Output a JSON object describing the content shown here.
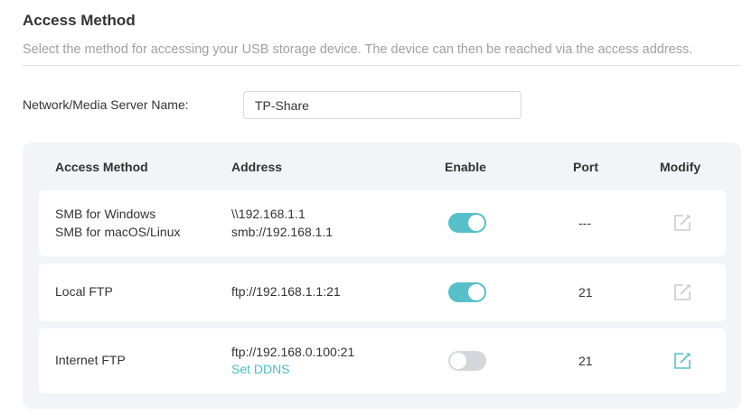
{
  "header": {
    "title": "Access Method",
    "description": "Select the method for accessing your USB storage device. The device can then be reached via the access address."
  },
  "server_name": {
    "label": "Network/Media Server Name:",
    "value": "TP-Share"
  },
  "table": {
    "columns": {
      "method": "Access Method",
      "address": "Address",
      "enable": "Enable",
      "port": "Port",
      "modify": "Modify"
    },
    "rows": [
      {
        "method": [
          "SMB for Windows",
          "SMB for macOS/Linux"
        ],
        "address": [
          "\\\\192.168.1.1",
          "smb://192.168.1.1"
        ],
        "enabled": true,
        "port": "---",
        "modify_icon": "edit-icon",
        "modify_enabled": false
      },
      {
        "method": [
          "Local FTP"
        ],
        "address": [
          "ftp://192.168.1.1:21"
        ],
        "enabled": true,
        "port": "21",
        "modify_icon": "edit-icon",
        "modify_enabled": false
      },
      {
        "method": [
          "Internet FTP"
        ],
        "address": [
          "ftp://192.168.0.100:21"
        ],
        "address_link": "Set DDNS",
        "enabled": false,
        "port": "21",
        "modify_icon": "edit-icon",
        "modify_enabled": true
      }
    ]
  },
  "colors": {
    "accent": "#56bfc8",
    "link": "#4bbbc6",
    "toggle_off": "#d3d6db",
    "icon_disabled": "#c8cbd0",
    "panel_bg": "#f3f4f8"
  }
}
